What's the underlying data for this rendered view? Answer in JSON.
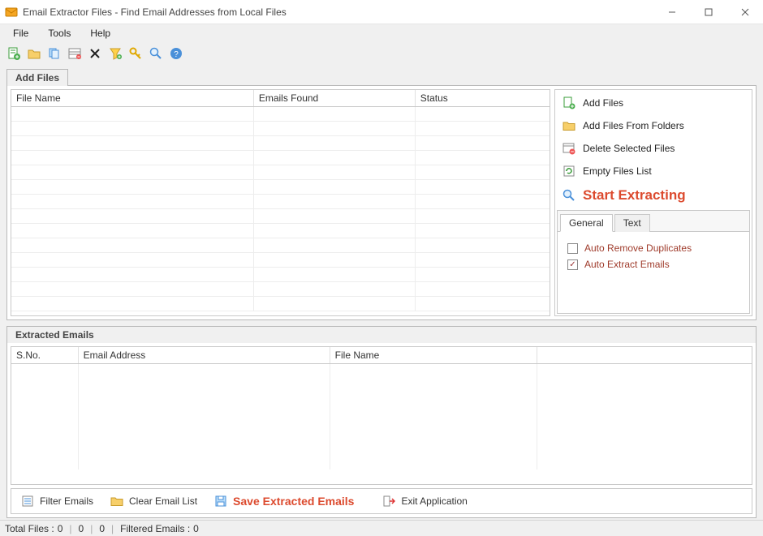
{
  "window": {
    "title": "Email Extractor Files -  Find Email Addresses from Local Files"
  },
  "menu": {
    "file": "File",
    "tools": "Tools",
    "help": "Help"
  },
  "tabs": {
    "add_files": "Add Files",
    "extracted_emails": "Extracted Emails"
  },
  "files_table": {
    "headers": {
      "filename": "File Name",
      "emails_found": "Emails Found",
      "status": "Status"
    },
    "rows": []
  },
  "side": {
    "add_files": "Add Files",
    "add_from_folders": "Add Files From Folders",
    "delete_selected": "Delete Selected Files",
    "empty_list": "Empty Files List",
    "start_extracting": "Start Extracting"
  },
  "subtabs": {
    "general": "General",
    "text": "Text"
  },
  "options": {
    "auto_remove_dup": "Auto Remove Duplicates",
    "auto_remove_dup_checked": false,
    "auto_extract_emails": "Auto Extract Emails",
    "auto_extract_emails_checked": true
  },
  "extracted_table": {
    "headers": {
      "sno": "S.No.",
      "email": "Email Address",
      "filename": "File Name"
    },
    "rows": []
  },
  "buttons": {
    "filter_emails": "Filter Emails",
    "clear_email_list": "Clear Email List",
    "save_extracted": "Save Extracted Emails",
    "exit_app": "Exit Application"
  },
  "status": {
    "total_files_label": "Total Files :",
    "total_files": "0",
    "n1": "0",
    "n2": "0",
    "filtered_label": "Filtered Emails :",
    "filtered": "0"
  }
}
